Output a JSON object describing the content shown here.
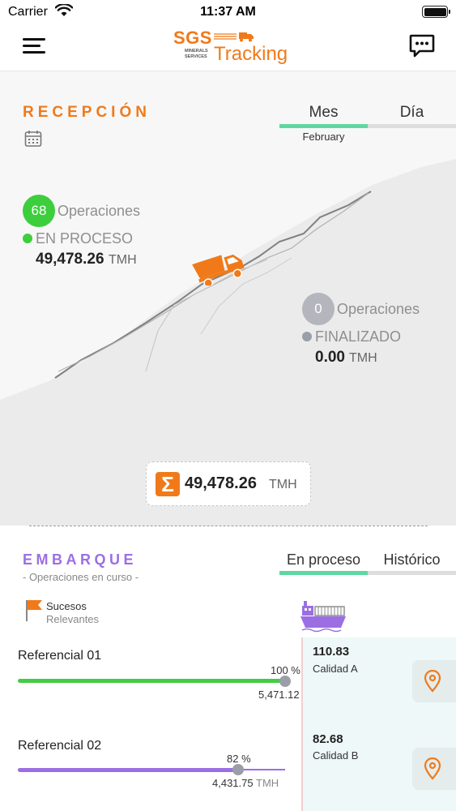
{
  "status": {
    "carrier": "Carrier",
    "time": "11:37 AM"
  },
  "header": {
    "logo_sgs": "SGS",
    "logo_sub_1": "MINERALS",
    "logo_sub_2": "SERVICES",
    "logo_tracking": "Tracking"
  },
  "recepcion": {
    "title": "RECEPCIÓN",
    "tabs": [
      {
        "label": "Mes",
        "active": true
      },
      {
        "label": "Día",
        "active": false
      }
    ],
    "month": "February",
    "proceso": {
      "count": "68",
      "ops_label": "Operaciones",
      "state": "EN PROCESO",
      "amount": "49,478.26",
      "unit": "TMH",
      "color": "#3dce3d"
    },
    "finalizado": {
      "count": "0",
      "ops_label": "Operaciones",
      "state": "FINALIZADO",
      "amount": "0.00",
      "unit": "TMH",
      "color": "#b5b5bd"
    },
    "total": {
      "value": "49,478.26",
      "unit": "TMH",
      "symbol": "Σ"
    }
  },
  "embarque": {
    "title": "EMBARQUE",
    "subtitle": "- Operaciones en curso -",
    "tabs": [
      {
        "label": "En proceso",
        "active": true
      },
      {
        "label": "Histórico",
        "active": false
      }
    ],
    "sucesos": "Sucesos",
    "relevantes": "Relevantes",
    "referencias": [
      {
        "name": "Referencial 01",
        "pct": "100 %",
        "progress": 1.0,
        "amount": "5,471.12",
        "unit": "",
        "quality_value": "110.83",
        "quality_label": "Calidad A",
        "color": "#44cc44"
      },
      {
        "name": "Referencial 02",
        "pct": "82 %",
        "progress": 0.82,
        "amount": "4,431.75",
        "unit": "TMH",
        "quality_value": "82.68",
        "quality_label": "Calidad B",
        "color": "#9b6fe3"
      }
    ]
  },
  "colors": {
    "accent_orange": "#f07a1a",
    "accent_purple": "#9b6fe3",
    "tab_active": "#5dd8a0",
    "tab_inactive": "#dddddd"
  }
}
